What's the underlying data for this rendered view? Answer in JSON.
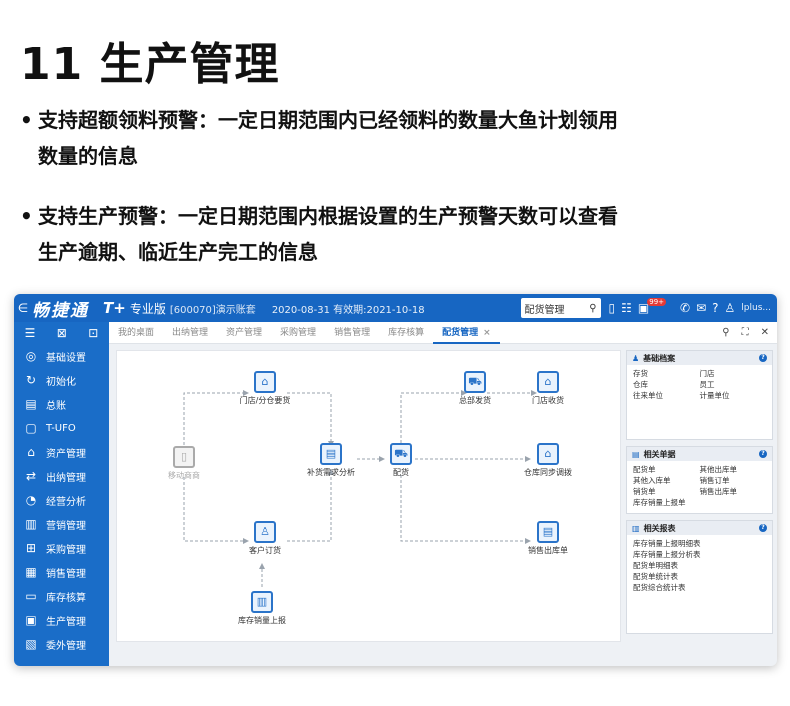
{
  "slide": {
    "title": "11 生产管理",
    "bullet1_line1": "支持超额领料预警：一定日期范围内已经领料的数量大鱼计划领用",
    "bullet1_line2": "数量的信息",
    "bullet2_line1": "支持生产预警：一定日期范围内根据设置的生产预警天数可以查看",
    "bullet2_line2": "生产逾期、临近生产完工的信息",
    "bullet_glyph": "•"
  },
  "app": {
    "back": "∈",
    "brand": "畅捷通",
    "tplus": "T+",
    "edition": "专业版",
    "account": "[600070]演示账套",
    "dates": "2020-08-31  有效期:2021-10-18",
    "search_text": "配货管理",
    "badge": "99+",
    "user": "lplus..."
  },
  "sidebar": {
    "tools": [
      "☰",
      "⊠",
      "⊡"
    ],
    "items": [
      {
        "icon": "◎",
        "label": "基础设置"
      },
      {
        "icon": "↻",
        "label": "初始化"
      },
      {
        "icon": "▤",
        "label": "总账"
      },
      {
        "icon": "▢",
        "label": "T-UFO"
      },
      {
        "icon": "⌂",
        "label": "资产管理"
      },
      {
        "icon": "⇄",
        "label": "出纳管理"
      },
      {
        "icon": "◔",
        "label": "经营分析"
      },
      {
        "icon": "▥",
        "label": "营销管理"
      },
      {
        "icon": "⊞",
        "label": "采购管理"
      },
      {
        "icon": "▦",
        "label": "销售管理"
      },
      {
        "icon": "▭",
        "label": "库存核算"
      },
      {
        "icon": "▣",
        "label": "生产管理"
      },
      {
        "icon": "▧",
        "label": "委外管理"
      }
    ]
  },
  "tabs": {
    "items": [
      "我的桌面",
      "出纳管理",
      "资产管理",
      "采购管理",
      "销售管理",
      "库存核算"
    ],
    "active": "配货管理",
    "close": "×"
  },
  "flow": {
    "nodes": {
      "mobile": "移动商商",
      "store_request": "门店/分仓要货",
      "replenish": "补货需求分析",
      "dispatch": "配货",
      "hq_ship": "总部发货",
      "store_receive": "门店收货",
      "warehouse_sync": "仓库同步调拨",
      "customer_order": "客户订货",
      "sales_outbound": "销售出库单",
      "stock_report": "库存销量上报"
    }
  },
  "panels": {
    "basic": {
      "title": "基础档案",
      "items": [
        "存货",
        "门店",
        "仓库",
        "员工",
        "往来单位",
        "计量单位"
      ]
    },
    "docs": {
      "title": "相关单据",
      "items": [
        "配货单",
        "其他出库单",
        "其他入库单",
        "销售订单",
        "销货单",
        "销售出库单",
        "库存销量上报单"
      ]
    },
    "reports": {
      "title": "相关报表",
      "items": [
        "库存销量上报明细表",
        "库存销量上报分析表",
        "配货单明细表",
        "配货单统计表",
        "配货综合统计表"
      ]
    }
  }
}
